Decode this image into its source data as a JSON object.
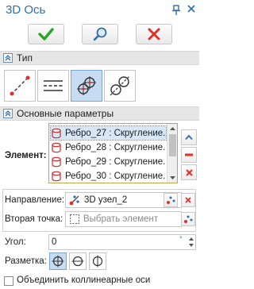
{
  "window": {
    "title": "3D Ось"
  },
  "actions": {
    "ok": "ok",
    "preview": "preview",
    "cancel": "cancel"
  },
  "sections": {
    "type_title": "Тип",
    "params_title": "Основные параметры"
  },
  "types": [
    {
      "icon": "line-axis-icon",
      "active": false
    },
    {
      "icon": "dashed-axis-icon",
      "active": false
    },
    {
      "icon": "node-axis-icon",
      "active": true
    },
    {
      "icon": "edge-axis-icon",
      "active": false
    }
  ],
  "element": {
    "label": "Элемент:",
    "items": [
      "Ребро_27 : Скругление...",
      "Ребро_28 : Скругление...",
      "Ребро_29 : Скругление...",
      "Ребро_30 : Скругление..."
    ],
    "selected_index": 0
  },
  "direction": {
    "label": "Направление:",
    "value": "3D узел_2"
  },
  "second_point": {
    "label": "Вторая точка:",
    "placeholder": "Выбрать элемент"
  },
  "angle": {
    "label": "Угол:",
    "value": "0",
    "unit": "°"
  },
  "marking": {
    "label": "Разметка:",
    "options": [
      "crosshair-icon",
      "circle-line-icon",
      "circle-vline-icon"
    ],
    "selected_index": 0
  },
  "merge": {
    "label": "Объединить коллинеарные оси",
    "checked": false
  },
  "colors": {
    "accent": "#2e6faa",
    "ok_green": "#2aa52a",
    "cancel_red": "#e0302a",
    "header_bg": "#e6e6e6",
    "active_bg": "#c7dcf3"
  }
}
